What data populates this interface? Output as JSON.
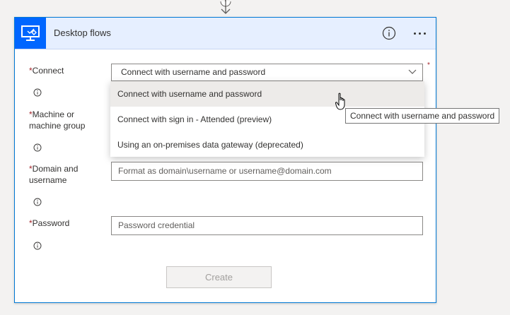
{
  "card": {
    "title": "Desktop flows",
    "icon": "desktop-flow-icon",
    "accent_color": "#0066ff",
    "header_background": "#e6efff"
  },
  "form": {
    "required_marker": "*",
    "fields": [
      {
        "label": "Connect",
        "info_icon": "info-icon"
      },
      {
        "label_line1": "Machine or",
        "label_line2": "machine group",
        "info_icon": "info-icon"
      },
      {
        "label_line1": "Domain and",
        "label_line2": "username",
        "info_icon": "info-icon"
      },
      {
        "label": "Password",
        "info_icon": "info-icon"
      }
    ],
    "connect_select": {
      "value": "Connect with username and password"
    },
    "domain_input": {
      "placeholder": "Format as domain\\username or username@domain.com"
    },
    "password_input": {
      "placeholder": "Password credential"
    },
    "create_button": "Create"
  },
  "dropdown": {
    "options": [
      {
        "label": "Connect with username and password",
        "selected": true
      },
      {
        "label": "Connect with sign in - Attended (preview)",
        "selected": false
      },
      {
        "label": "Using an on-premises data gateway (deprecated)",
        "selected": false
      }
    ]
  },
  "tooltip": {
    "text": "Connect with username and password"
  }
}
